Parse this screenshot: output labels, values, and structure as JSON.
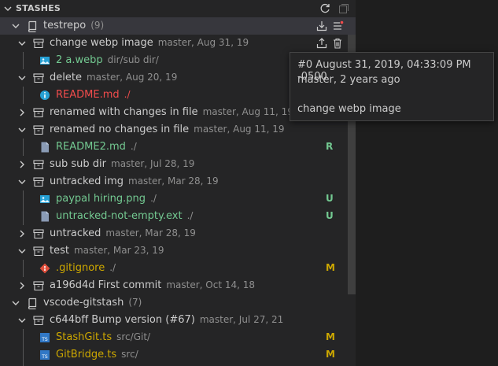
{
  "header": {
    "title": "STASHES"
  },
  "repos": [
    {
      "name": "testrepo",
      "count": "(9)",
      "stashes": [
        {
          "label": "change webp image",
          "desc": "master, Aug 31, 19",
          "files": [
            {
              "name": "2 a.webp",
              "path": "dir/sub dir/",
              "status": ""
            }
          ]
        },
        {
          "label": "delete",
          "desc": "master, Aug 20, 19",
          "files": [
            {
              "name": "README.md",
              "path": "./",
              "status": ""
            }
          ]
        },
        {
          "label": "renamed with changes in file",
          "desc": "master, Aug 11, 19",
          "files": []
        },
        {
          "label": "renamed no changes in file",
          "desc": "master, Aug 11, 19",
          "files": [
            {
              "name": "README2.md",
              "path": "./",
              "status": "R"
            }
          ]
        },
        {
          "label": "sub sub dir",
          "desc": "master, Jul 28, 19",
          "files": []
        },
        {
          "label": "untracked img",
          "desc": "master, Mar 28, 19",
          "files": [
            {
              "name": "paypal hiring.png",
              "path": "./",
              "status": "U"
            },
            {
              "name": "untracked-not-empty.ext",
              "path": "./",
              "status": "U"
            }
          ]
        },
        {
          "label": "untracked",
          "desc": "master, Mar 28, 19",
          "files": []
        },
        {
          "label": "test",
          "desc": "master, Mar 23, 19",
          "files": [
            {
              "name": ".gitignore",
              "path": "./",
              "status": "M"
            }
          ]
        },
        {
          "label": "a196d4d First commit",
          "desc": "master, Oct 14, 18",
          "files": []
        }
      ]
    },
    {
      "name": "vscode-gitstash",
      "count": "(7)",
      "stashes": [
        {
          "label": "c644bff Bump version (#67)",
          "desc": "master, Jul 27, 21",
          "files": [
            {
              "name": "StashGit.ts",
              "path": "src/Git/",
              "status": "M"
            },
            {
              "name": "GitBridge.ts",
              "path": "src/",
              "status": "M"
            }
          ]
        }
      ]
    }
  ],
  "tooltip": {
    "line1": "#0  August 31, 2019, 04:33:09 PM -0500",
    "line2": "master, 2 years ago",
    "line3": "change webp image"
  },
  "colors": {
    "accent_red": "#f14c4c",
    "modified": "#cca700",
    "untracked": "#73c991"
  }
}
